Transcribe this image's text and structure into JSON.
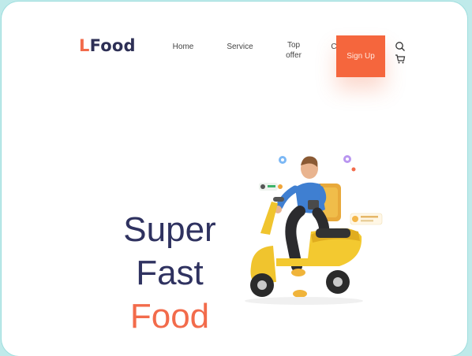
{
  "brand": {
    "first_letter": "L",
    "rest": "Food"
  },
  "nav": {
    "items": [
      {
        "label": "Home"
      },
      {
        "label": "Service"
      },
      {
        "label": "Top offer"
      },
      {
        "label": "C"
      }
    ],
    "signup_label": "Sign Up"
  },
  "hero": {
    "line1": "Super",
    "line2": "Fast",
    "line3": "Food"
  },
  "colors": {
    "accent": "#f26b4b",
    "signup_bg": "#f5663d",
    "heading": "#2f3260",
    "scooter": "#f0c42e"
  },
  "icons": [
    "search-icon",
    "cart-icon",
    "delivery-scooter-illustration"
  ]
}
